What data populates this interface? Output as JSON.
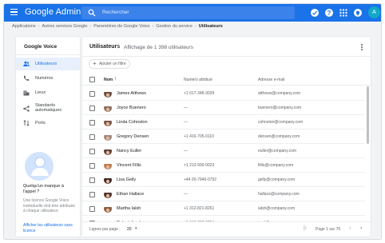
{
  "app": {
    "title": "Google Admin",
    "search_placeholder": "Rechercher",
    "avatar_letter": "A",
    "brand_color": "#1a73e8"
  },
  "breadcrumb": [
    "Applications",
    "Autres services Google",
    "Paramètres de Google Voice",
    "Gestion du service",
    "Utilisateurs"
  ],
  "sidebar": {
    "title": "Google Voice",
    "items": [
      {
        "label": "Utilisateurs",
        "icon": "users-icon",
        "active": true
      },
      {
        "label": "Numéros",
        "icon": "phone-icon",
        "active": false
      },
      {
        "label": "Lieux",
        "icon": "building-icon",
        "active": false
      },
      {
        "label": "Standards automatiques",
        "icon": "share-icon",
        "active": false
      },
      {
        "label": "Ports",
        "icon": "port-icon",
        "active": false
      }
    ],
    "promo_question": "Quelqu'un manque à l'appel ?",
    "promo_description": "Une licence Google Voice individuelle doit être attribuée à chaque utilisateur.",
    "promo_link": "Afficher les utilisateurs sans licence"
  },
  "main": {
    "title": "Utilisateurs",
    "count": "Affichage de 1 398 utilisateurs",
    "filter_label": "Ajouter un filtre",
    "columns": {
      "name": "Nom",
      "number": "Numéro attribué",
      "email": "Adresse e-mail"
    },
    "rows": [
      {
        "name": "James Atthews",
        "number": "+1 617-348-3039",
        "email": "atthews@company.com",
        "avatar_color": "#6d4c41"
      },
      {
        "name": "Joyce Buenero",
        "number": "—",
        "email": "buenero@company.com",
        "avatar_color": "#8d6e63"
      },
      {
        "name": "Linda Cohnston",
        "number": "—",
        "email": "cohnston@company.com",
        "avatar_color": "#795548"
      },
      {
        "name": "Gregory Densen",
        "number": "+1 416-705-0110",
        "email": "densen@company.com",
        "avatar_color": "#a1887f"
      },
      {
        "name": "Nancy Euller",
        "number": "—",
        "email": "euller@company.com",
        "avatar_color": "#5d4037"
      },
      {
        "name": "Vincent Fillis",
        "number": "+1 213-930-0023",
        "email": "fillis@company.com",
        "avatar_color": "#bf7b4f"
      },
      {
        "name": "Lisa Gelly",
        "number": "+44 20-7946-0792",
        "email": "gelly@company.com",
        "avatar_color": "#3e2723"
      },
      {
        "name": "Ethan Hallace",
        "number": "—",
        "email": "hallace@company.com",
        "avatar_color": "#4e342e"
      },
      {
        "name": "Martha Ialsh",
        "number": "+1 312-821-8261",
        "email": "ialsh@company.com",
        "avatar_color": "#8d5b3f"
      },
      {
        "name": "Robert Jand",
        "number": "+1 646-332-0234",
        "email": "jand@company.com",
        "avatar_color": "#6a4a3a"
      }
    ],
    "footer": {
      "rows_label": "Lignes par page :",
      "rows_per_page": "20",
      "page_info": "Page 1 sur 70"
    }
  }
}
